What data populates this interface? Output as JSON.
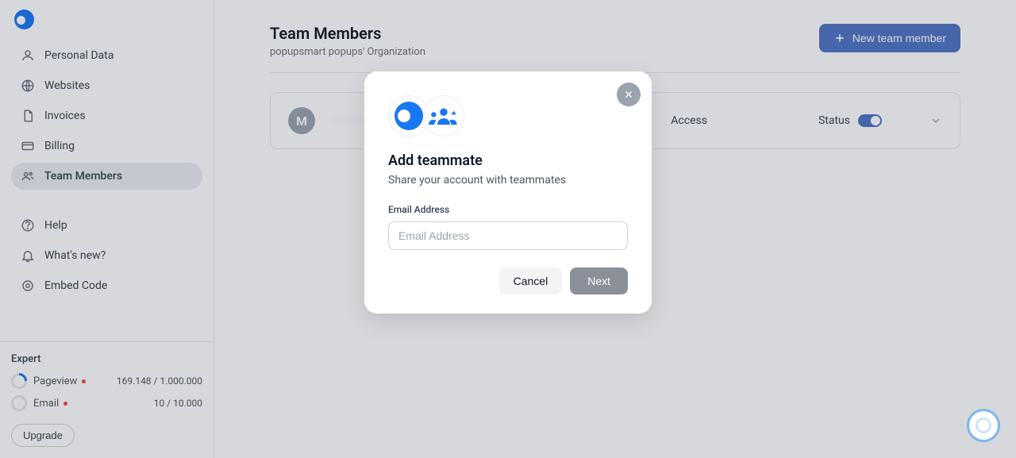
{
  "sidebar": {
    "items": [
      {
        "label": "Personal Data"
      },
      {
        "label": "Websites"
      },
      {
        "label": "Invoices"
      },
      {
        "label": "Billing"
      },
      {
        "label": "Team Members"
      },
      {
        "label": "Help"
      },
      {
        "label": "What's new?"
      },
      {
        "label": "Embed Code"
      }
    ],
    "usage": {
      "title": "Expert",
      "pageview_label": "Pageview",
      "pageview_value": "169.148 / 1.000.000",
      "email_label": "Email",
      "email_value": "10 / 10.000",
      "upgrade_label": "Upgrade"
    }
  },
  "main": {
    "title": "Team Members",
    "subtitle": "popupsmart popups' Organization",
    "new_member_label": "New team member",
    "member_initial": "M",
    "member_name_hidden": "———— ———",
    "access_label": "Access",
    "status_label": "Status"
  },
  "modal": {
    "title": "Add teammate",
    "subtitle": "Share your account with teammates",
    "field_label": "Email Address",
    "placeholder": "Email Address",
    "cancel_label": "Cancel",
    "next_label": "Next"
  }
}
